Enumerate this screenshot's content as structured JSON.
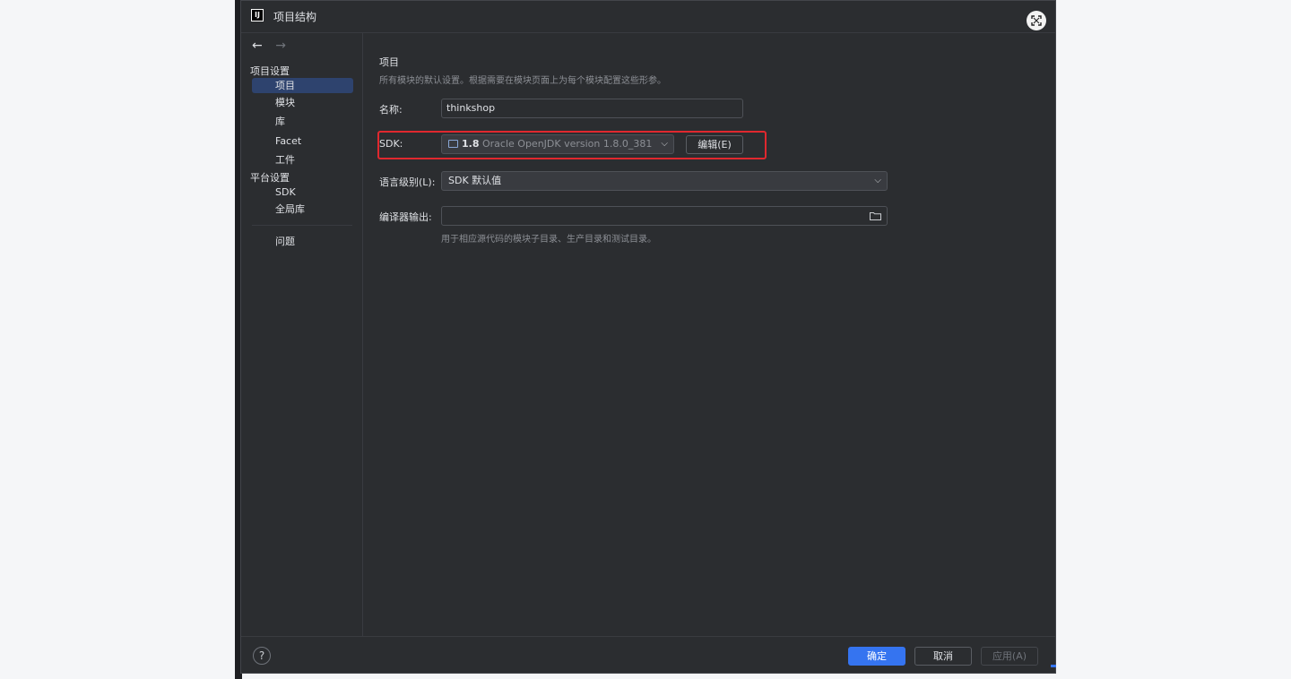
{
  "window": {
    "title": "项目结构",
    "app_icon": "IJ"
  },
  "nav": {
    "back": "←",
    "forward": "→"
  },
  "sidebar": {
    "project_settings_label": "项目设置",
    "platform_settings_label": "平台设置",
    "items": [
      {
        "label": "项目",
        "selected": true
      },
      {
        "label": "模块"
      },
      {
        "label": "库"
      },
      {
        "label": "Facet"
      },
      {
        "label": "工件"
      },
      {
        "label": "SDK"
      },
      {
        "label": "全局库"
      },
      {
        "label": "问题"
      }
    ]
  },
  "content": {
    "heading": "项目",
    "description": "所有模块的默认设置。根据需要在模块页面上为每个模块配置这些形参。",
    "name_label": "名称:",
    "name_value": "thinkshop",
    "sdk_label": "SDK:",
    "sdk_version": "1.8",
    "sdk_name": "Oracle OpenJDK version 1.8.0_381",
    "edit_button": "编辑(E)",
    "language_level_label": "语言级别(L):",
    "language_level_value": "SDK 默认值",
    "compiler_output_label": "编译器输出:",
    "compiler_output_value": "",
    "compiler_output_hint": "用于相应源代码的模块子目录、生产目录和测试目录。"
  },
  "footer": {
    "help": "?",
    "ok": "确定",
    "cancel": "取消",
    "apply": "应用(A)"
  },
  "colors": {
    "dialog_bg": "#2b2d30",
    "selection": "#2e436e",
    "primary_button": "#3574f0",
    "highlight_box": "#e0282e"
  }
}
